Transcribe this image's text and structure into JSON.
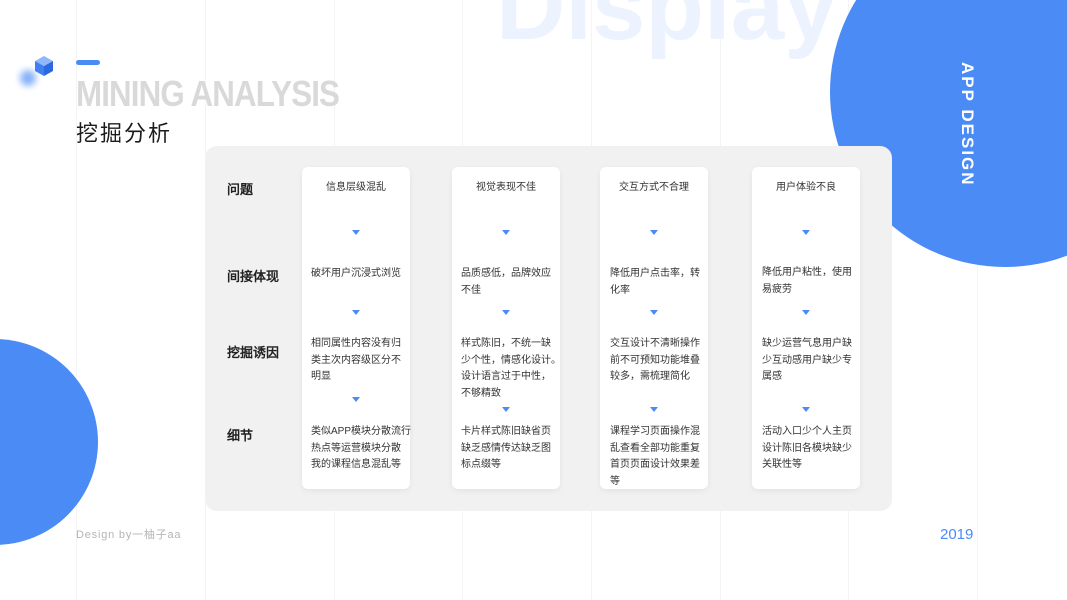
{
  "header": {
    "watermark": "Display",
    "title_en": "MINING ANALYSIS",
    "title_cn": "挖掘分析",
    "side_label": "APP DESIGN"
  },
  "icons": {
    "logo": "cube-icon",
    "arrow": "triangle-down-icon"
  },
  "table": {
    "row_labels": [
      "问题",
      "间接体现",
      "挖掘诱因",
      "细节"
    ],
    "cards": [
      {
        "problem": "信息层级混乱",
        "indirect": [
          "破坏用户沉浸式浏览"
        ],
        "cause": [
          "相同属性内容没有归",
          "类主次内容级区分不",
          "明显"
        ],
        "detail": [
          "类似APP模块分散流行",
          "热点等运营模块分散",
          "我的课程信息混乱等"
        ]
      },
      {
        "problem": "视觉表现不佳",
        "indirect": [
          "品质感低，品牌效应",
          "不佳"
        ],
        "cause": [
          "样式陈旧，不统一缺",
          "少个性，情感化设计。",
          "设计语言过于中性，",
          "不够精致"
        ],
        "detail": [
          "卡片样式陈旧缺省页",
          "缺乏感情传达缺乏图",
          "标点缀等"
        ]
      },
      {
        "problem": "交互方式不合理",
        "indirect": [
          "降低用户点击率，转",
          "化率"
        ],
        "cause": [
          "交互设计不清晰操作",
          "前不可预知功能堆叠",
          "较多，需梳理简化"
        ],
        "detail": [
          "课程学习页面操作混",
          "乱查看全部功能重复",
          "首页页面设计效果差",
          "等"
        ]
      },
      {
        "problem": "用户体验不良",
        "indirect": [
          "降低用户粘性，使用",
          "易疲劳"
        ],
        "cause": [
          "缺少运营气息用户缺",
          "少互动感用户缺少专",
          "属感"
        ],
        "detail": [
          "活动入口少个人主页",
          "设计陈旧各模块缺少",
          "关联性等"
        ]
      }
    ]
  },
  "footer": {
    "credit": "Design by一柚子aa",
    "year": "2019"
  },
  "colors": {
    "accent": "#4b8bf5",
    "panel": "#f1f1f1",
    "watermark": "#edf3fe",
    "title_en": "#d9d9d9",
    "background": "#ffffff"
  }
}
